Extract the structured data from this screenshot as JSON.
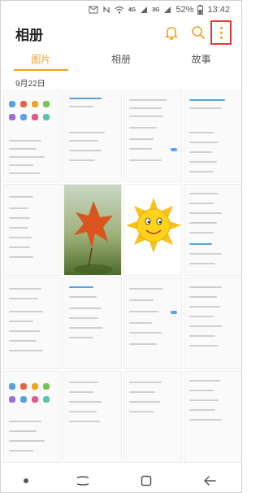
{
  "status_bar": {
    "network_label": "4G",
    "network_label_2": "3G",
    "battery": "52%",
    "time": "13:42"
  },
  "header": {
    "title": "相册"
  },
  "tabs": [
    {
      "label": "图片",
      "active": true
    },
    {
      "label": "相册",
      "active": false
    },
    {
      "label": "故事",
      "active": false
    }
  ],
  "date_label": "9月22日",
  "colors": {
    "accent": "#f2a01e",
    "highlight_box": "#e53935"
  },
  "icons": {
    "bell": "bell-icon",
    "search": "search-icon",
    "more": "more-vertical-icon"
  }
}
